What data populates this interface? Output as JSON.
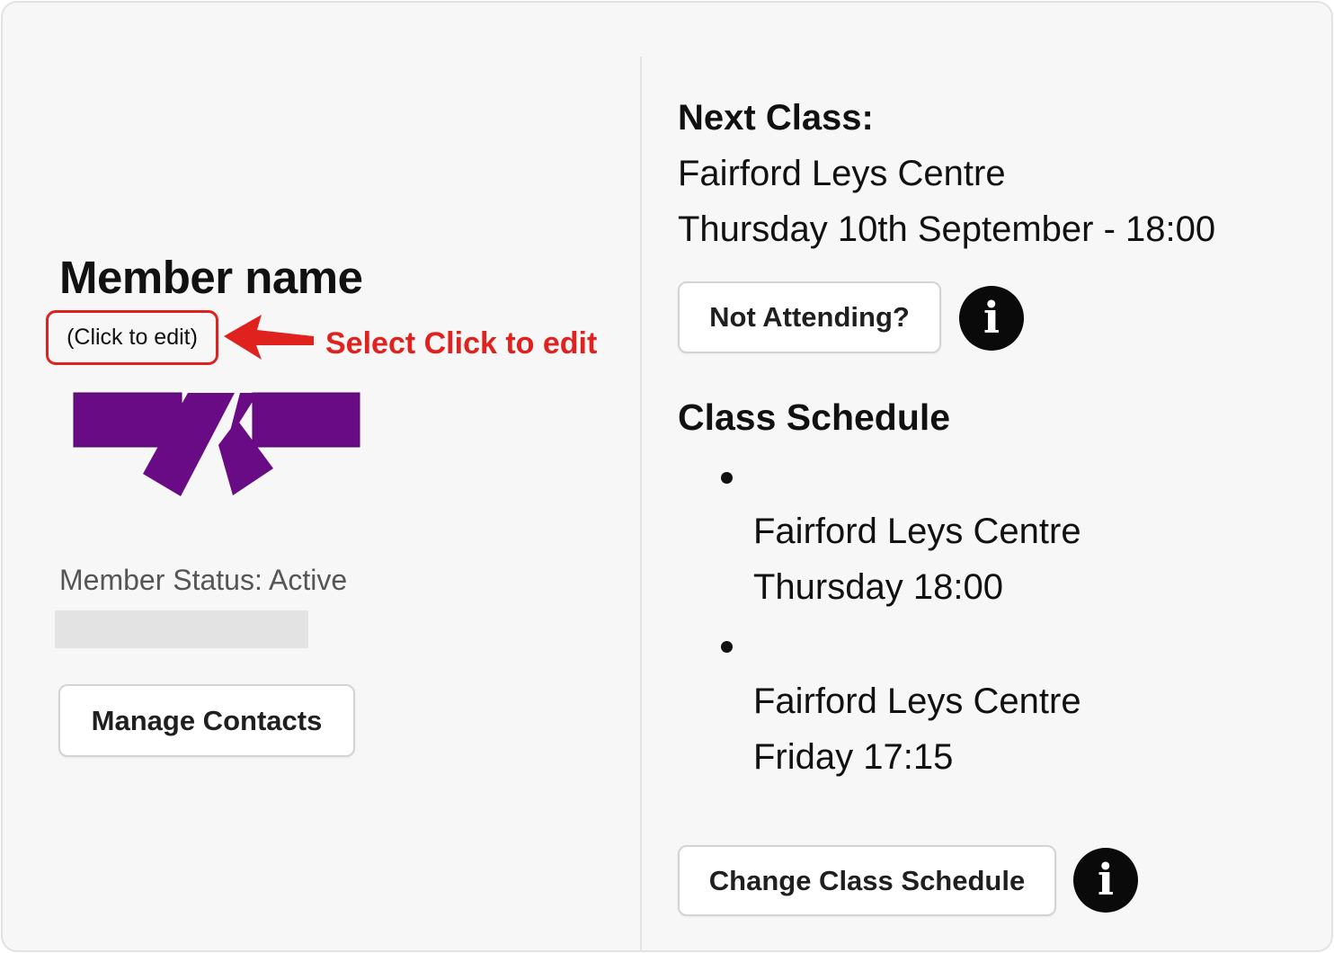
{
  "member": {
    "name": "Member name",
    "edit_link": "(Click to edit)",
    "status": "Member Status: Active",
    "belt_color": "#6a0b86",
    "manage_contacts_label": "Manage Contacts"
  },
  "annotation": {
    "text": "Select Click to edit",
    "color": "#e0221f"
  },
  "next_class": {
    "heading": "Next Class:",
    "location": "Fairford Leys Centre",
    "datetime": "Thursday 10th September - 18:00",
    "not_attending_label": "Not Attending?",
    "info_icon": "i"
  },
  "class_schedule": {
    "heading": "Class Schedule",
    "items": [
      {
        "location": "Fairford Leys Centre",
        "time": "Thursday 18:00"
      },
      {
        "location": "Fairford Leys Centre",
        "time": "Friday 17:15"
      }
    ],
    "change_label": "Change Class Schedule",
    "info_icon": "i"
  }
}
